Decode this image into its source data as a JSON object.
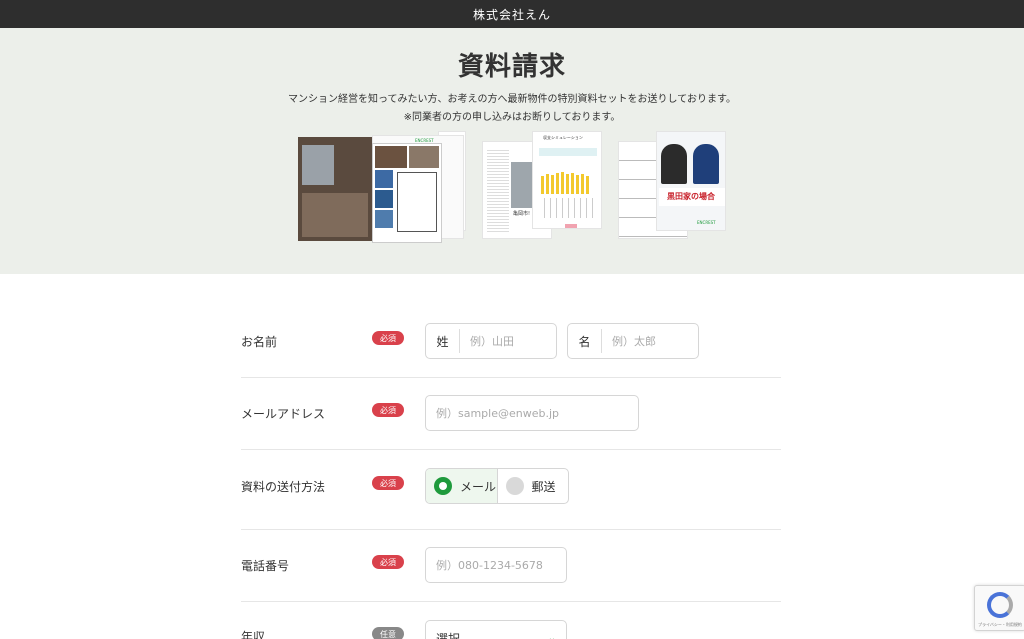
{
  "header": {
    "company": "株式会社えん"
  },
  "hero": {
    "title": "資料請求",
    "line1": "マンション経営を知ってみたい方、お考えの方へ最新物件の特別資料セットをお送りしております。",
    "line2": "※同業者の方の申し込みはお断りしております。",
    "images": {
      "set1_logo": "ENCREST",
      "set2_heading": "収支シミュレーション",
      "set2_city": "亀岡市!",
      "set3_title": "黒田家の場合",
      "set3_logo": "ENCREST"
    }
  },
  "form": {
    "name": {
      "label": "お名前",
      "badge": "必須",
      "last_prefix": "姓",
      "last_placeholder": "例）山田",
      "first_prefix": "名",
      "first_placeholder": "例）太郎"
    },
    "email": {
      "label": "メールアドレス",
      "badge": "必須",
      "placeholder": "例）sample@enweb.jp"
    },
    "delivery": {
      "label": "資料の送付方法",
      "badge": "必須",
      "options": [
        "メール",
        "郵送"
      ],
      "selected": "メール"
    },
    "phone": {
      "label": "電話番号",
      "badge": "必須",
      "placeholder": "例）080-1234-5678"
    },
    "income": {
      "label": "年収",
      "badge": "任意",
      "select_value": "選択"
    }
  },
  "recaptcha": {
    "text": "プライバシー・利用規約"
  },
  "colors": {
    "header_bg": "#2e2e2e",
    "hero_bg": "#ecefea",
    "required": "#d9414b",
    "optional": "#888888",
    "accent": "#1e9a3c"
  }
}
